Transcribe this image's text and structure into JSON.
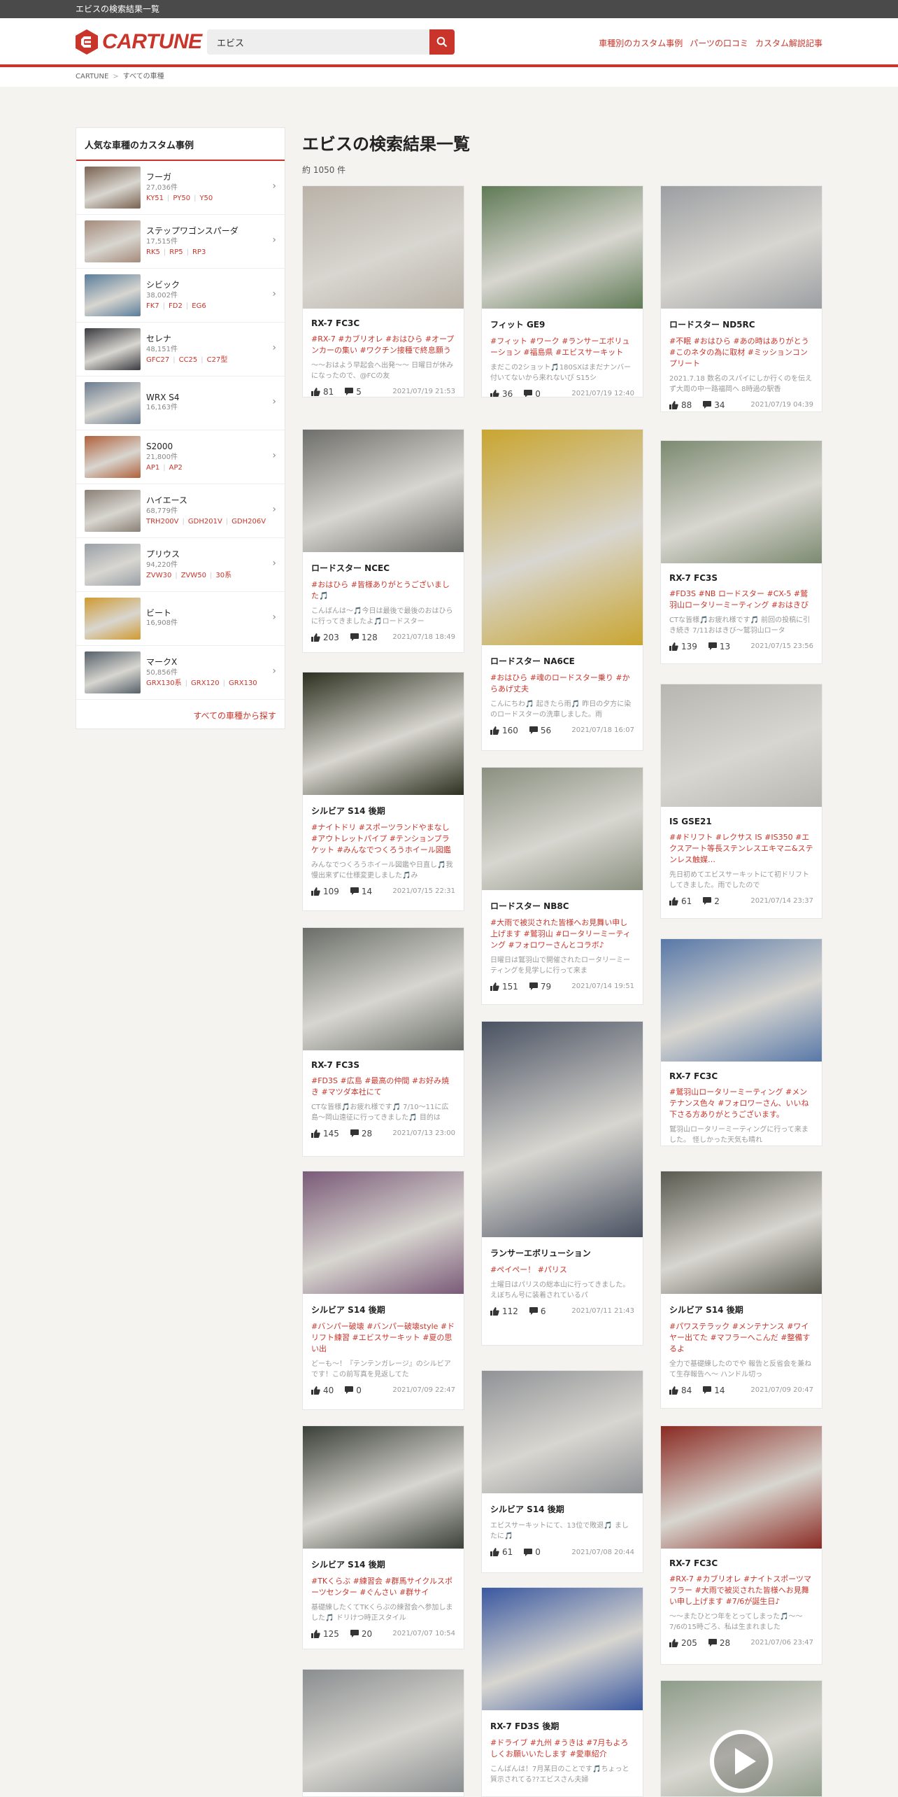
{
  "window": {
    "title": "エビスの検索結果一覧"
  },
  "header": {
    "logo_text": "CARTUNE",
    "search_value": "エビス",
    "nav": [
      "車種別のカスタム事例",
      "パーツの口コミ",
      "カスタム解説記事"
    ]
  },
  "breadcrumb": [
    "CARTUNE",
    "すべての車種"
  ],
  "sidebar": {
    "title": "人気な車種のカスタム事例",
    "more": "すべての車種から探す",
    "items": [
      {
        "name": "フーガ",
        "count": "27,036件",
        "codes": [
          "KY51",
          "PY50",
          "Y50"
        ],
        "color": "#7a6250"
      },
      {
        "name": "ステップワゴンスパーダ",
        "count": "17,515件",
        "codes": [
          "RK5",
          "RP5",
          "RP3"
        ],
        "color": "#a58a7a"
      },
      {
        "name": "シビック",
        "count": "38,002件",
        "codes": [
          "FK7",
          "FD2",
          "EG6"
        ],
        "color": "#5a7d9a"
      },
      {
        "name": "セレナ",
        "count": "48,151件",
        "codes": [
          "GFC27",
          "CC25",
          "C27型"
        ],
        "color": "#3a3a40"
      },
      {
        "name": "WRX S4",
        "count": "16,163件",
        "codes": [],
        "color": "#6b7c90"
      },
      {
        "name": "S2000",
        "count": "21,800件",
        "codes": [
          "AP1",
          "AP2"
        ],
        "color": "#b0603a"
      },
      {
        "name": "ハイエース",
        "count": "68,779件",
        "codes": [
          "TRH200V",
          "GDH201V",
          "GDH206V"
        ],
        "color": "#8a8076"
      },
      {
        "name": "プリウス",
        "count": "94,220件",
        "codes": [
          "ZVW30",
          "ZVW50",
          "30系"
        ],
        "color": "#9aa0a8"
      },
      {
        "name": "ビート",
        "count": "16,908件",
        "codes": [],
        "color": "#d09a30"
      },
      {
        "name": "マークX",
        "count": "50,856件",
        "codes": [
          "GRX130系",
          "GRX120",
          "GRX130"
        ],
        "color": "#55606a"
      }
    ]
  },
  "main": {
    "title": "エビスの検索結果一覧",
    "count": "約 1050 件",
    "cards": [
      {
        "title": "RX-7 FC3C",
        "tags": "#RX-7 #カブリオレ #おはひら #オープンカーの集い #ワクチン接種で終息願う",
        "desc": "〜〜おはよう早起会へ出発〜〜 日曜日が休みになったので、@FCの友",
        "likes": "81",
        "comments": "5",
        "date": "2021/07/19 21:53",
        "color": "#b9b2a8"
      },
      {
        "title": "フィット GE9",
        "tags": "#フィット #ワーク #ランサーエボリューション #福島県 #エビスサーキット",
        "desc": "まだこの2ショット🎵180SXはまだナンバー付いてないから来れないぴ S15シ",
        "likes": "36",
        "comments": "0",
        "date": "2021/07/19 12:40",
        "color": "#5f7a55"
      },
      {
        "title": "ロードスター ND5RC",
        "tags": "#不眠 #おはひら #あの時はありがとう #このネタの為に取材 #ミッションコンプリート",
        "desc": "2021.7.18 数名のスパイにしか行くのを伝えず大周の中一路福岡へ 8時過の駅香",
        "likes": "88",
        "comments": "34",
        "date": "2021/07/19 04:39",
        "color": "#9c9ea2"
      },
      {
        "title": "ロードスター NCEC",
        "tags": "#おはひら #皆様ありがとうございました🎵",
        "desc": "こんばんは〜🎵今日は最後で最後のおはひらに行ってきましたよ🎵ロードスター",
        "likes": "203",
        "comments": "128",
        "date": "2021/07/18 18:49",
        "color": "#6e6e6a"
      },
      {
        "title": "ロードスター NA6CE",
        "tags": "#おはひら #魂のロードスター乗り #からあげ丈夫",
        "desc": "こんにちわ🎵 起きたら雨🎵 昨日の夕方に染のロードスターの洗車しました。雨",
        "likes": "160",
        "comments": "56",
        "date": "2021/07/18 16:07",
        "color": "#c9a530"
      },
      {
        "title": "RX-7 FC3S",
        "tags": "#FD3S #NB ロードスター #CX-5 #鷲羽山ロータリーミーティング #おはきび",
        "desc": "CTな皆様🎵お疲れ様です🎵 前回の投稿に引き続き 7/11おはきび〜鷲羽山ロータ",
        "likes": "139",
        "comments": "13",
        "date": "2021/07/15 23:56",
        "color": "#7c8a70"
      },
      {
        "title": "シルビア S14 後期",
        "tags": "#ナイトドリ #スポーツランドやまなし #アウトレットパイプ #テンションプラケット #みんなでつくろうホイール図鑑",
        "desc": "みんなでつくろうホイール図鑑や日直し🎵我慢出来ずに仕様変更しました🎵み",
        "likes": "109",
        "comments": "14",
        "date": "2021/07/15 22:31",
        "color": "#2d3020"
      },
      {
        "title": "ロードスター NB8C",
        "tags": "#大雨で被災された皆様へお見舞い申し上げます #鷲羽山 #ロータリーミーティング #フォロワーさんとコラボ♪",
        "desc": "日曜日は鷲羽山で開催されたロータリーミーティングを見学しに行って来ま",
        "likes": "151",
        "comments": "79",
        "date": "2021/07/14 19:51",
        "color": "#8a9080"
      },
      {
        "title": "IS GSE21",
        "tags": "##ドリフト #レクサス IS #IS350 #エクスアート等長ステンレスエキマニ&ステンレス触媒…",
        "desc": "先日初めてエビスサーキットにて初ドリフトしてきました。雨でしたので",
        "likes": "61",
        "comments": "2",
        "date": "2021/07/14 23:37",
        "color": "#b8b6b0"
      },
      {
        "title": "RX-7 FC3S",
        "tags": "#FD3S #広島 #最高の仲間 #お好み焼き #マツダ本社にて",
        "desc": "CTな皆様🎵お疲れ様です🎵 7/10〜11に広島〜岡山遠征に行ってきました🎵 目的は",
        "likes": "145",
        "comments": "28",
        "date": "2021/07/13 23:00",
        "color": "#6a6e68"
      },
      {
        "title": "ランサーエボリューション",
        "tags": "#ペイペー！ #パリス",
        "desc": "土曜日はパリスの総本山に行ってきました。えぼちん号に装着されているパ",
        "likes": "112",
        "comments": "6",
        "date": "2021/07/11 21:43",
        "color": "#4a5262"
      },
      {
        "title": "RX-7 FC3C",
        "tags": "#鷲羽山ロータリーミーティング #メンテナンス色々 #フォロワーさん、いいね下さる方ありがとうございます。",
        "desc": "鷲羽山ロータリーミーティングに行って来ました。 怪しかった天気も晴れ",
        "likes": "107",
        "comments": "51",
        "date": "2021/07/11 20:29",
        "color": "#5878a8"
      },
      {
        "title": "シルビア S14 後期",
        "tags": "#バンパー破壊 #バンパー破壊style #ドリフト練習 #エビスサーキット #夏の思い出",
        "desc": "どーも〜！『テンテンガレージ』のシルビアです！この前写真を見返してた",
        "likes": "40",
        "comments": "0",
        "date": "2021/07/09 22:47",
        "color": "#7a5a78"
      },
      {
        "title": "シルビア S14 後期",
        "tags": "#パワステラック #メンテナンス #ワイヤー出てた #マフラーへこんだ #整備するよ",
        "desc": "全力で基礎練したのでや 報告と反省会を兼ねて生存報告へ〜 ハンドル切っ",
        "likes": "84",
        "comments": "14",
        "date": "2021/07/09 20:47",
        "color": "#5a5a50"
      },
      {
        "title": "シルビア S14 後期",
        "tags": "",
        "desc": "エビスサーキットにて、13位で敗退🎵 ましたに🎵",
        "likes": "61",
        "comments": "0",
        "date": "2021/07/08 20:44",
        "color": "#909296"
      },
      {
        "title": "シルビア S14 後期",
        "tags": "#TKくらぶ #練習会 #群馬サイクルスポーツセンター #ぐんさい #群サイ",
        "desc": "基礎練したくてTKくらぶの練習会へ参加しました🎵 ドリけつ時正スタイル",
        "likes": "125",
        "comments": "20",
        "date": "2021/07/07 10:54",
        "color": "#3a4038"
      },
      {
        "title": "RX-7 FC3C",
        "tags": "#RX-7 #カブリオレ #ナイトスポーツマフラー #大雨で被災された皆様へお見舞い申し上げます #7/6が誕生日♪",
        "desc": "〜〜またひとつ年をとってしまった🎵〜〜 7/6の15時ごろ、私は生まれました",
        "likes": "205",
        "comments": "28",
        "date": "2021/07/06 23:47",
        "color": "#8a2a22"
      },
      {
        "title": "RX-7 FD3S 後期",
        "tags": "#ドライブ #九州 #うきは #7月もよろしくお願いいたします #愛車紹介",
        "desc": "こんばんは！7月某日のことです🎵ちょっと質示されてる??エビスさん夫婦",
        "likes": "",
        "comments": "",
        "date": "",
        "color": "#3a58a0"
      },
      {
        "title": "",
        "tags": "",
        "desc": "",
        "likes": "",
        "comments": "",
        "date": "",
        "color": "#8a8e90"
      },
      {
        "title": "",
        "tags": "",
        "desc": "",
        "likes": "",
        "comments": "",
        "date": "",
        "color": "#8e9c8a"
      }
    ]
  }
}
